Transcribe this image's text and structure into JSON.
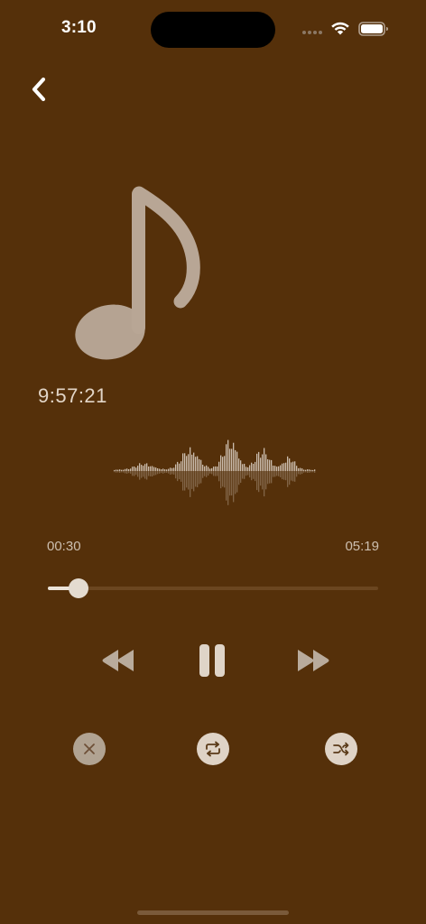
{
  "status_bar": {
    "time": "3:10",
    "icons": [
      "signal-dots-icon",
      "wifi-icon",
      "battery-icon"
    ]
  },
  "nav": {
    "back_icon": "chevron-left-icon"
  },
  "artwork": {
    "icon": "music-note-icon"
  },
  "clock": {
    "text": "9:57:21"
  },
  "player": {
    "current_time": "00:30",
    "total_time": "05:19",
    "progress_fraction": 0.094,
    "controls": {
      "rewind_icon": "rewind-icon",
      "pause_icon": "pause-icon",
      "forward_icon": "fast-forward-icon"
    },
    "options": {
      "close_icon": "close-icon",
      "repeat_icon": "repeat-icon",
      "shuffle_icon": "shuffle-icon"
    }
  },
  "colors": {
    "background": "#55300a",
    "accent_light": "#e4dbd0",
    "text": "#d9cbbb"
  }
}
